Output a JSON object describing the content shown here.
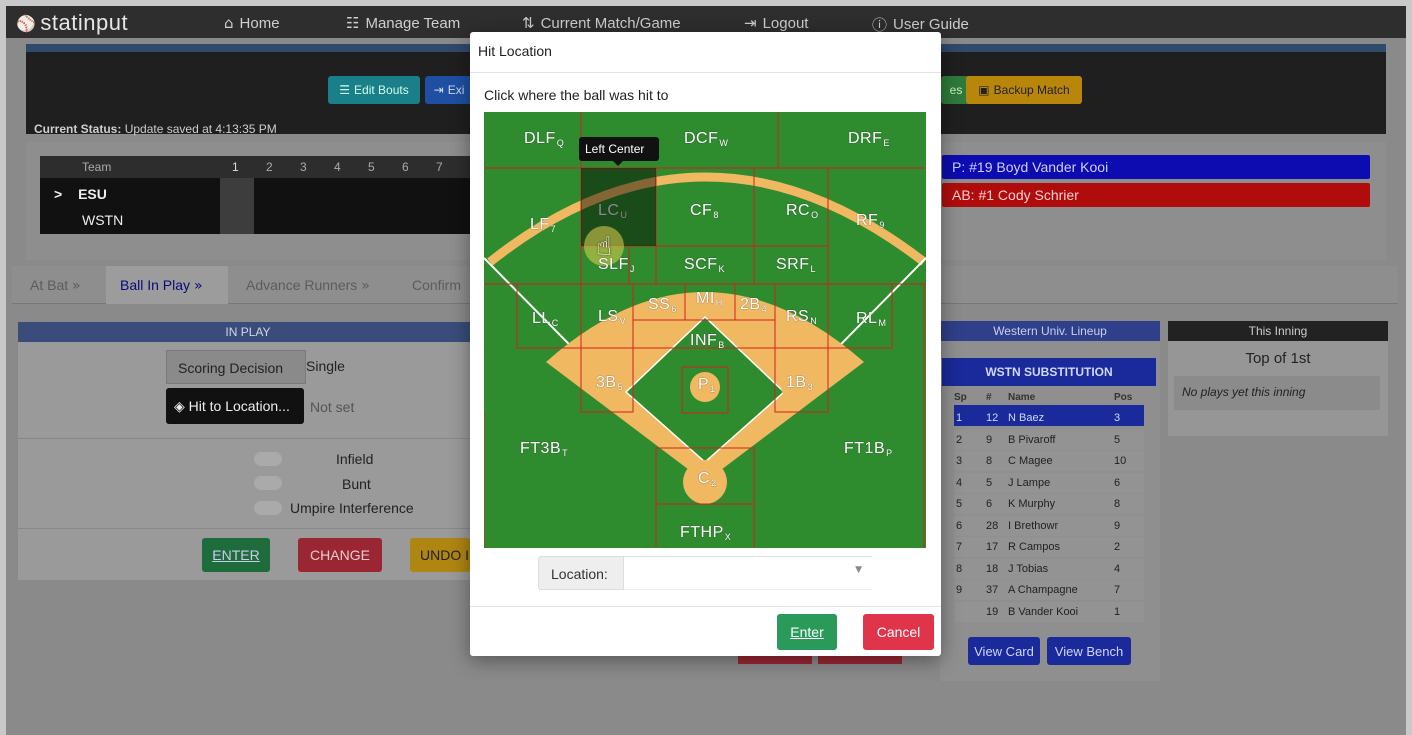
{
  "nav": {
    "brand": "statinput",
    "items": [
      {
        "label": "Home",
        "icon": "home-icon"
      },
      {
        "label": "Manage Team",
        "icon": "team-icon"
      },
      {
        "label": "Current Match/Game",
        "icon": "match-icon"
      },
      {
        "label": "Logout",
        "icon": "logout-icon"
      },
      {
        "label": "User Guide",
        "icon": "info-icon"
      }
    ]
  },
  "toolbar": {
    "edit_bouts": "Edit Bouts",
    "exit": "Exi",
    "partial": "es",
    "backup": "Backup Match"
  },
  "status": {
    "label": "Current Status:",
    "text": "Update saved at 4:13:35 PM"
  },
  "scoreboard": {
    "team_header": "Team",
    "innings": [
      "1",
      "2",
      "3",
      "4",
      "5",
      "6",
      "7"
    ],
    "teams": [
      {
        "marker": ">",
        "name": "ESU"
      },
      {
        "marker": "",
        "name": "WSTN"
      }
    ]
  },
  "matchup": {
    "pitcher": "P: #19 Boyd Vander Kooi",
    "batter": "AB: #1 Cody Schrier"
  },
  "tabs": [
    {
      "label": "At Bat"
    },
    {
      "label": "Ball In Play"
    },
    {
      "label": "Advance Runners"
    },
    {
      "label": "Confirm"
    }
  ],
  "inplay": {
    "header": "IN PLAY",
    "scoring_label": "Scoring Decision",
    "scoring_value": "Single",
    "hit_button": "Hit to Location...",
    "hit_value": "Not set",
    "toggles": [
      "Infield",
      "Bunt",
      "Umpire Interference"
    ],
    "enter": "ENTER",
    "change": "CHANGE",
    "undo": "UNDO I"
  },
  "lineup": {
    "header": "Western Univ. Lineup",
    "sub_header": "WSTN SUBSTITUTION",
    "columns": [
      "Sp",
      "#",
      "Name",
      "Pos"
    ],
    "rows": [
      {
        "sp": "1",
        "num": "12",
        "name": "N Baez",
        "pos": "3"
      },
      {
        "sp": "2",
        "num": "9",
        "name": "B Pivaroff",
        "pos": "5"
      },
      {
        "sp": "3",
        "num": "8",
        "name": "C Magee",
        "pos": "10"
      },
      {
        "sp": "4",
        "num": "5",
        "name": "J Lampe",
        "pos": "6"
      },
      {
        "sp": "5",
        "num": "6",
        "name": "K Murphy",
        "pos": "8"
      },
      {
        "sp": "6",
        "num": "28",
        "name": "I Brethowr",
        "pos": "9"
      },
      {
        "sp": "7",
        "num": "17",
        "name": "R Campos",
        "pos": "2"
      },
      {
        "sp": "8",
        "num": "18",
        "name": "J Tobias",
        "pos": "4"
      },
      {
        "sp": "9",
        "num": "37",
        "name": "A Champagne",
        "pos": "7"
      },
      {
        "sp": "",
        "num": "19",
        "name": "B Vander Kooi",
        "pos": "1"
      }
    ],
    "view_card": "View Card",
    "view_bench": "View Bench"
  },
  "this_inning": {
    "header": "This Inning",
    "title": "Top of 1st",
    "empty": "No plays yet this inning"
  },
  "modal": {
    "title": "Hit Location",
    "subtitle": "Click where the ball was hit to",
    "tooltip": "Left Center",
    "location_label": "Location:",
    "location_value": "",
    "enter": "Enter",
    "cancel": "Cancel",
    "zones": [
      {
        "name": "DLF",
        "sub": "Q"
      },
      {
        "name": "DCF",
        "sub": "W"
      },
      {
        "name": "DRF",
        "sub": "E"
      },
      {
        "name": "LF",
        "sub": "7"
      },
      {
        "name": "LC",
        "sub": "U"
      },
      {
        "name": "CF",
        "sub": "8"
      },
      {
        "name": "RC",
        "sub": "O"
      },
      {
        "name": "RF",
        "sub": "9"
      },
      {
        "name": "SLF",
        "sub": "J"
      },
      {
        "name": "SCF",
        "sub": "K"
      },
      {
        "name": "SRF",
        "sub": "L"
      },
      {
        "name": "LL",
        "sub": "C"
      },
      {
        "name": "LS",
        "sub": "V"
      },
      {
        "name": "SS",
        "sub": "6"
      },
      {
        "name": "MI",
        "sub": "H"
      },
      {
        "name": "2B",
        "sub": "4"
      },
      {
        "name": "RS",
        "sub": "N"
      },
      {
        "name": "RL",
        "sub": "M"
      },
      {
        "name": "INF",
        "sub": "B"
      },
      {
        "name": "3B",
        "sub": "5"
      },
      {
        "name": "P",
        "sub": "1"
      },
      {
        "name": "1B",
        "sub": "3"
      },
      {
        "name": "FT3B",
        "sub": "T"
      },
      {
        "name": "FT1B",
        "sub": "P"
      },
      {
        "name": "C",
        "sub": "2"
      },
      {
        "name": "FTHP",
        "sub": "X"
      }
    ]
  },
  "colors": {
    "field_green": "#2e8b2e",
    "infield_dirt": "#f0b860",
    "zone_line": "#d42020",
    "enter_green": "#2a9a5a",
    "cancel_red": "#e0344a"
  }
}
